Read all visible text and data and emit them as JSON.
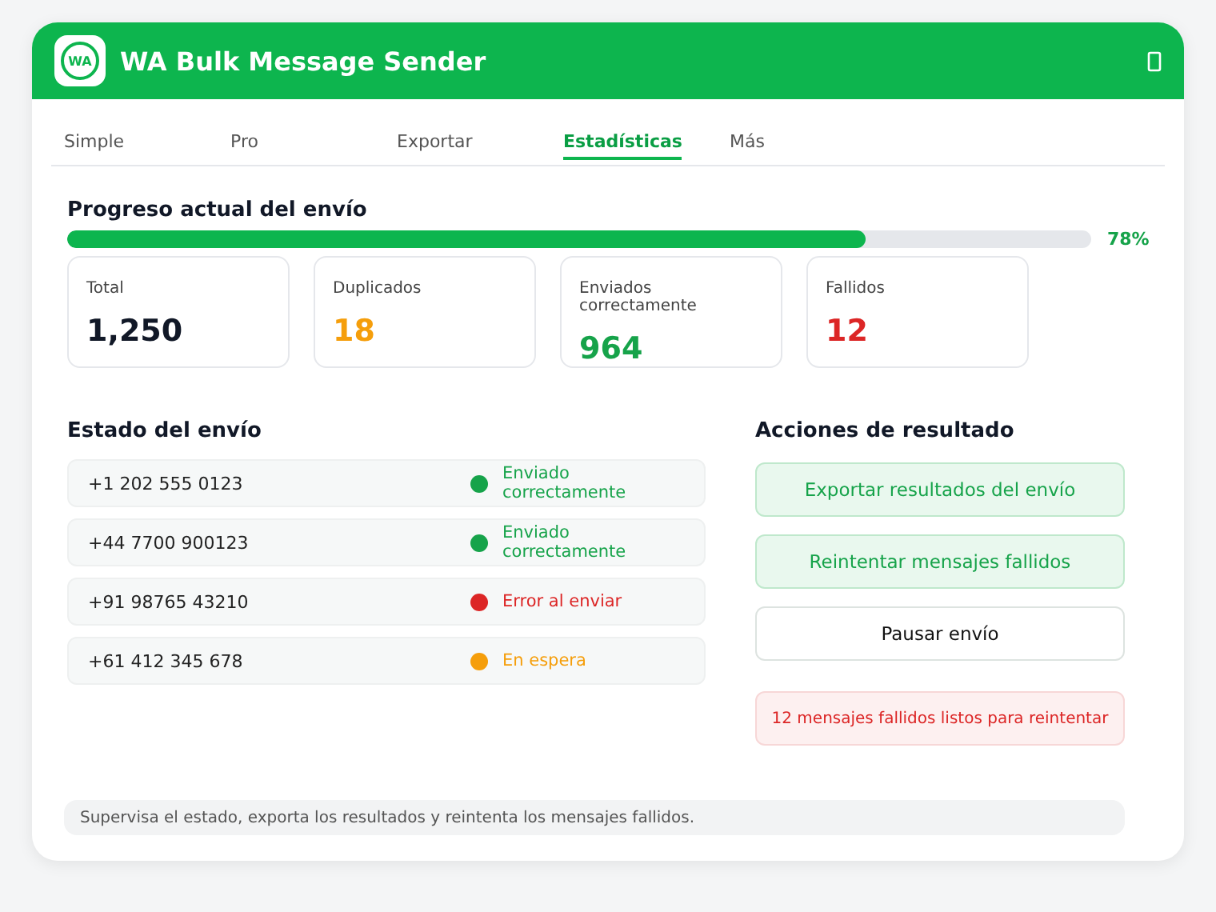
{
  "window": {
    "logo": "WA",
    "title": "WA Bulk Message Sender"
  },
  "tabs": [
    {
      "label": "Simple",
      "selected": false
    },
    {
      "label": "Pro",
      "selected": false
    },
    {
      "label": "Exportar",
      "selected": false
    },
    {
      "label": "Estadísticas",
      "selected": true
    },
    {
      "label": "Más",
      "selected": false
    }
  ],
  "progress": {
    "title": "Progreso actual del envío",
    "level": 0.78,
    "reading": "78%"
  },
  "stats": [
    {
      "label": "Total",
      "value": "1,250",
      "color": "#111827"
    },
    {
      "label": "Duplicados",
      "value": "18",
      "color": "#f59e0b"
    },
    {
      "label": "Enviados correctamente",
      "value": "964",
      "color": "#16a34a"
    },
    {
      "label": "Fallidos",
      "value": "12",
      "color": "#dc2626"
    }
  ],
  "status": {
    "title": "Estado del envío",
    "rows": [
      {
        "number": "+1 202 555 0123",
        "status": "Enviado correctamente",
        "color": "#16a34a"
      },
      {
        "number": "+44 7700 900123",
        "status": "Enviado correctamente",
        "color": "#16a34a"
      },
      {
        "number": "+91 98765 43210",
        "status": "Error al enviar",
        "color": "#dc2626"
      },
      {
        "number": "+61 412 345 678",
        "status": "En espera",
        "color": "#f59e0b"
      }
    ]
  },
  "actions": {
    "title": "Acciones de resultado",
    "items": [
      {
        "kind": "primary",
        "label": "Exportar resultados del envío"
      },
      {
        "kind": "primary",
        "label": "Reintentar mensajes fallidos"
      },
      {
        "kind": "plain",
        "label": "Pausar envío"
      },
      {
        "kind": "notice",
        "label": "12 mensajes fallidos listos para reintentar"
      }
    ]
  },
  "footer": "Supervisa el estado, exporta los resultados y reintenta los mensajes fallidos."
}
